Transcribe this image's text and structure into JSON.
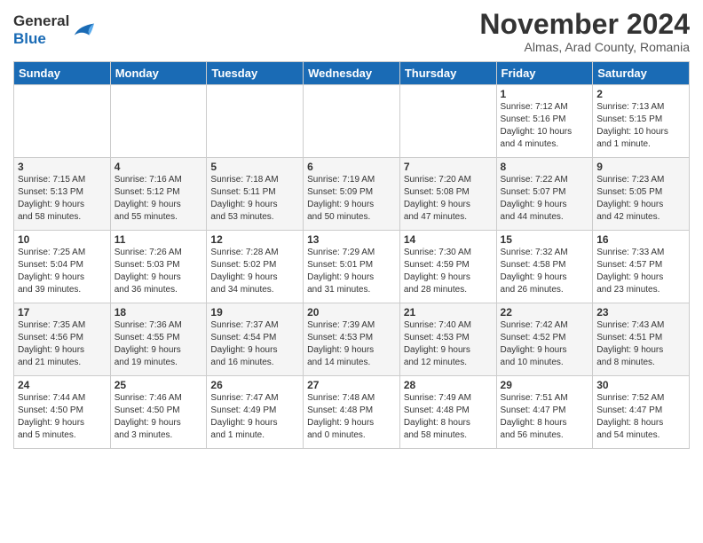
{
  "header": {
    "logo_line1": "General",
    "logo_line2": "Blue",
    "month_title": "November 2024",
    "location": "Almas, Arad County, Romania"
  },
  "weekdays": [
    "Sunday",
    "Monday",
    "Tuesday",
    "Wednesday",
    "Thursday",
    "Friday",
    "Saturday"
  ],
  "weeks": [
    [
      {
        "day": "",
        "info": ""
      },
      {
        "day": "",
        "info": ""
      },
      {
        "day": "",
        "info": ""
      },
      {
        "day": "",
        "info": ""
      },
      {
        "day": "",
        "info": ""
      },
      {
        "day": "1",
        "info": "Sunrise: 7:12 AM\nSunset: 5:16 PM\nDaylight: 10 hours\nand 4 minutes."
      },
      {
        "day": "2",
        "info": "Sunrise: 7:13 AM\nSunset: 5:15 PM\nDaylight: 10 hours\nand 1 minute."
      }
    ],
    [
      {
        "day": "3",
        "info": "Sunrise: 7:15 AM\nSunset: 5:13 PM\nDaylight: 9 hours\nand 58 minutes."
      },
      {
        "day": "4",
        "info": "Sunrise: 7:16 AM\nSunset: 5:12 PM\nDaylight: 9 hours\nand 55 minutes."
      },
      {
        "day": "5",
        "info": "Sunrise: 7:18 AM\nSunset: 5:11 PM\nDaylight: 9 hours\nand 53 minutes."
      },
      {
        "day": "6",
        "info": "Sunrise: 7:19 AM\nSunset: 5:09 PM\nDaylight: 9 hours\nand 50 minutes."
      },
      {
        "day": "7",
        "info": "Sunrise: 7:20 AM\nSunset: 5:08 PM\nDaylight: 9 hours\nand 47 minutes."
      },
      {
        "day": "8",
        "info": "Sunrise: 7:22 AM\nSunset: 5:07 PM\nDaylight: 9 hours\nand 44 minutes."
      },
      {
        "day": "9",
        "info": "Sunrise: 7:23 AM\nSunset: 5:05 PM\nDaylight: 9 hours\nand 42 minutes."
      }
    ],
    [
      {
        "day": "10",
        "info": "Sunrise: 7:25 AM\nSunset: 5:04 PM\nDaylight: 9 hours\nand 39 minutes."
      },
      {
        "day": "11",
        "info": "Sunrise: 7:26 AM\nSunset: 5:03 PM\nDaylight: 9 hours\nand 36 minutes."
      },
      {
        "day": "12",
        "info": "Sunrise: 7:28 AM\nSunset: 5:02 PM\nDaylight: 9 hours\nand 34 minutes."
      },
      {
        "day": "13",
        "info": "Sunrise: 7:29 AM\nSunset: 5:01 PM\nDaylight: 9 hours\nand 31 minutes."
      },
      {
        "day": "14",
        "info": "Sunrise: 7:30 AM\nSunset: 4:59 PM\nDaylight: 9 hours\nand 28 minutes."
      },
      {
        "day": "15",
        "info": "Sunrise: 7:32 AM\nSunset: 4:58 PM\nDaylight: 9 hours\nand 26 minutes."
      },
      {
        "day": "16",
        "info": "Sunrise: 7:33 AM\nSunset: 4:57 PM\nDaylight: 9 hours\nand 23 minutes."
      }
    ],
    [
      {
        "day": "17",
        "info": "Sunrise: 7:35 AM\nSunset: 4:56 PM\nDaylight: 9 hours\nand 21 minutes."
      },
      {
        "day": "18",
        "info": "Sunrise: 7:36 AM\nSunset: 4:55 PM\nDaylight: 9 hours\nand 19 minutes."
      },
      {
        "day": "19",
        "info": "Sunrise: 7:37 AM\nSunset: 4:54 PM\nDaylight: 9 hours\nand 16 minutes."
      },
      {
        "day": "20",
        "info": "Sunrise: 7:39 AM\nSunset: 4:53 PM\nDaylight: 9 hours\nand 14 minutes."
      },
      {
        "day": "21",
        "info": "Sunrise: 7:40 AM\nSunset: 4:53 PM\nDaylight: 9 hours\nand 12 minutes."
      },
      {
        "day": "22",
        "info": "Sunrise: 7:42 AM\nSunset: 4:52 PM\nDaylight: 9 hours\nand 10 minutes."
      },
      {
        "day": "23",
        "info": "Sunrise: 7:43 AM\nSunset: 4:51 PM\nDaylight: 9 hours\nand 8 minutes."
      }
    ],
    [
      {
        "day": "24",
        "info": "Sunrise: 7:44 AM\nSunset: 4:50 PM\nDaylight: 9 hours\nand 5 minutes."
      },
      {
        "day": "25",
        "info": "Sunrise: 7:46 AM\nSunset: 4:50 PM\nDaylight: 9 hours\nand 3 minutes."
      },
      {
        "day": "26",
        "info": "Sunrise: 7:47 AM\nSunset: 4:49 PM\nDaylight: 9 hours\nand 1 minute."
      },
      {
        "day": "27",
        "info": "Sunrise: 7:48 AM\nSunset: 4:48 PM\nDaylight: 9 hours\nand 0 minutes."
      },
      {
        "day": "28",
        "info": "Sunrise: 7:49 AM\nSunset: 4:48 PM\nDaylight: 8 hours\nand 58 minutes."
      },
      {
        "day": "29",
        "info": "Sunrise: 7:51 AM\nSunset: 4:47 PM\nDaylight: 8 hours\nand 56 minutes."
      },
      {
        "day": "30",
        "info": "Sunrise: 7:52 AM\nSunset: 4:47 PM\nDaylight: 8 hours\nand 54 minutes."
      }
    ]
  ]
}
